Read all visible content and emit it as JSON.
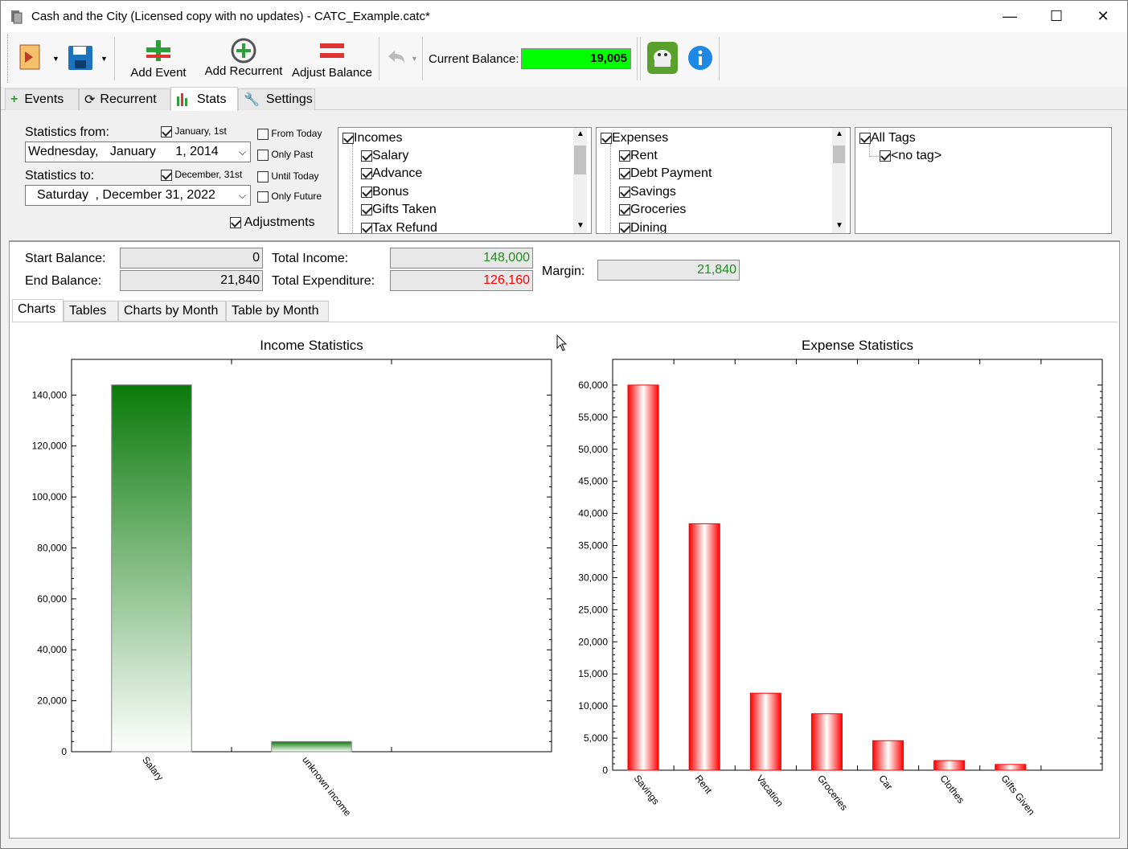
{
  "window": {
    "title": "Cash and the City (Licensed copy with no updates) - CATC_Example.catc*",
    "minimize_glyph": "—",
    "maximize_glyph": "☐",
    "close_glyph": "✕"
  },
  "toolbar": {
    "add_event": "Add Event",
    "add_recurrent": "Add Recurrent",
    "adjust_balance": "Adjust Balance",
    "current_balance_label": "Current Balance:",
    "current_balance_value": "19,005",
    "balance_color": "#00ff00"
  },
  "tabs": [
    {
      "label": "Events"
    },
    {
      "label": "Recurrent"
    },
    {
      "label": "Stats"
    },
    {
      "label": "Settings"
    }
  ],
  "filters": {
    "from_label": "Statistics from:",
    "from_check_label": "January, 1st",
    "from_date_day": "Wednesday,",
    "from_date_month": "January",
    "from_date_rest": "1, 2014",
    "to_label": "Statistics to:",
    "to_check_label": "December, 31st",
    "to_date_day": "Saturday",
    "to_date_rest": ", December 31, 2022",
    "from_today": "From Today",
    "only_past": "Only Past",
    "until_today": "Until Today",
    "only_future": "Only Future",
    "adjustments": "Adjustments"
  },
  "incomes": {
    "root": "Incomes",
    "items": [
      "Salary",
      "Advance",
      "Bonus",
      "Gifts Taken",
      "Tax Refund"
    ]
  },
  "expenses": {
    "root": "Expenses",
    "items": [
      "Rent",
      "Debt Payment",
      "Savings",
      "Groceries",
      "Dining"
    ]
  },
  "tags": {
    "root": "All Tags",
    "items": [
      "<no tag>"
    ]
  },
  "summary": {
    "start_balance_label": "Start Balance:",
    "start_balance": "0",
    "end_balance_label": "End Balance:",
    "end_balance": "21,840",
    "total_income_label": "Total Income:",
    "total_income": "148,000",
    "total_expenditure_label": "Total Expenditure:",
    "total_expenditure": "126,160",
    "margin_label": "Margin:",
    "margin": "21,840",
    "income_color": "#228b22",
    "expense_color": "#ff0000"
  },
  "subtabs": [
    {
      "label": "Charts"
    },
    {
      "label": "Tables"
    },
    {
      "label": "Charts by Month"
    },
    {
      "label": "Table by Month"
    }
  ],
  "chart_data": [
    {
      "type": "bar",
      "title": "Income Statistics",
      "categories": [
        "Salary",
        "unknown income"
      ],
      "values": [
        144000,
        4000
      ],
      "ylim": [
        0,
        154000
      ],
      "yticks": [
        0,
        20000,
        40000,
        60000,
        80000,
        100000,
        120000,
        140000
      ],
      "ytick_labels": [
        "0",
        "20,000",
        "40,000",
        "60,000",
        "80,000",
        "100,000",
        "120,000",
        "140,000"
      ],
      "color": "#0a7a0a",
      "grid": false
    },
    {
      "type": "bar",
      "title": "Expense Statistics",
      "categories": [
        "Savings",
        "Rent",
        "Vacation",
        "Groceries",
        "Car",
        "Clothes",
        "Gifts Given"
      ],
      "values": [
        60000,
        38400,
        12000,
        8800,
        4600,
        1500,
        900
      ],
      "ylim": [
        0,
        64000
      ],
      "yticks": [
        0,
        5000,
        10000,
        15000,
        20000,
        25000,
        30000,
        35000,
        40000,
        45000,
        50000,
        55000,
        60000
      ],
      "ytick_labels": [
        "0",
        "5,000",
        "10,000",
        "15,000",
        "20,000",
        "25,000",
        "30,000",
        "35,000",
        "40,000",
        "45,000",
        "50,000",
        "55,000",
        "60,000"
      ],
      "color": "#ff0000",
      "grid": false
    }
  ]
}
